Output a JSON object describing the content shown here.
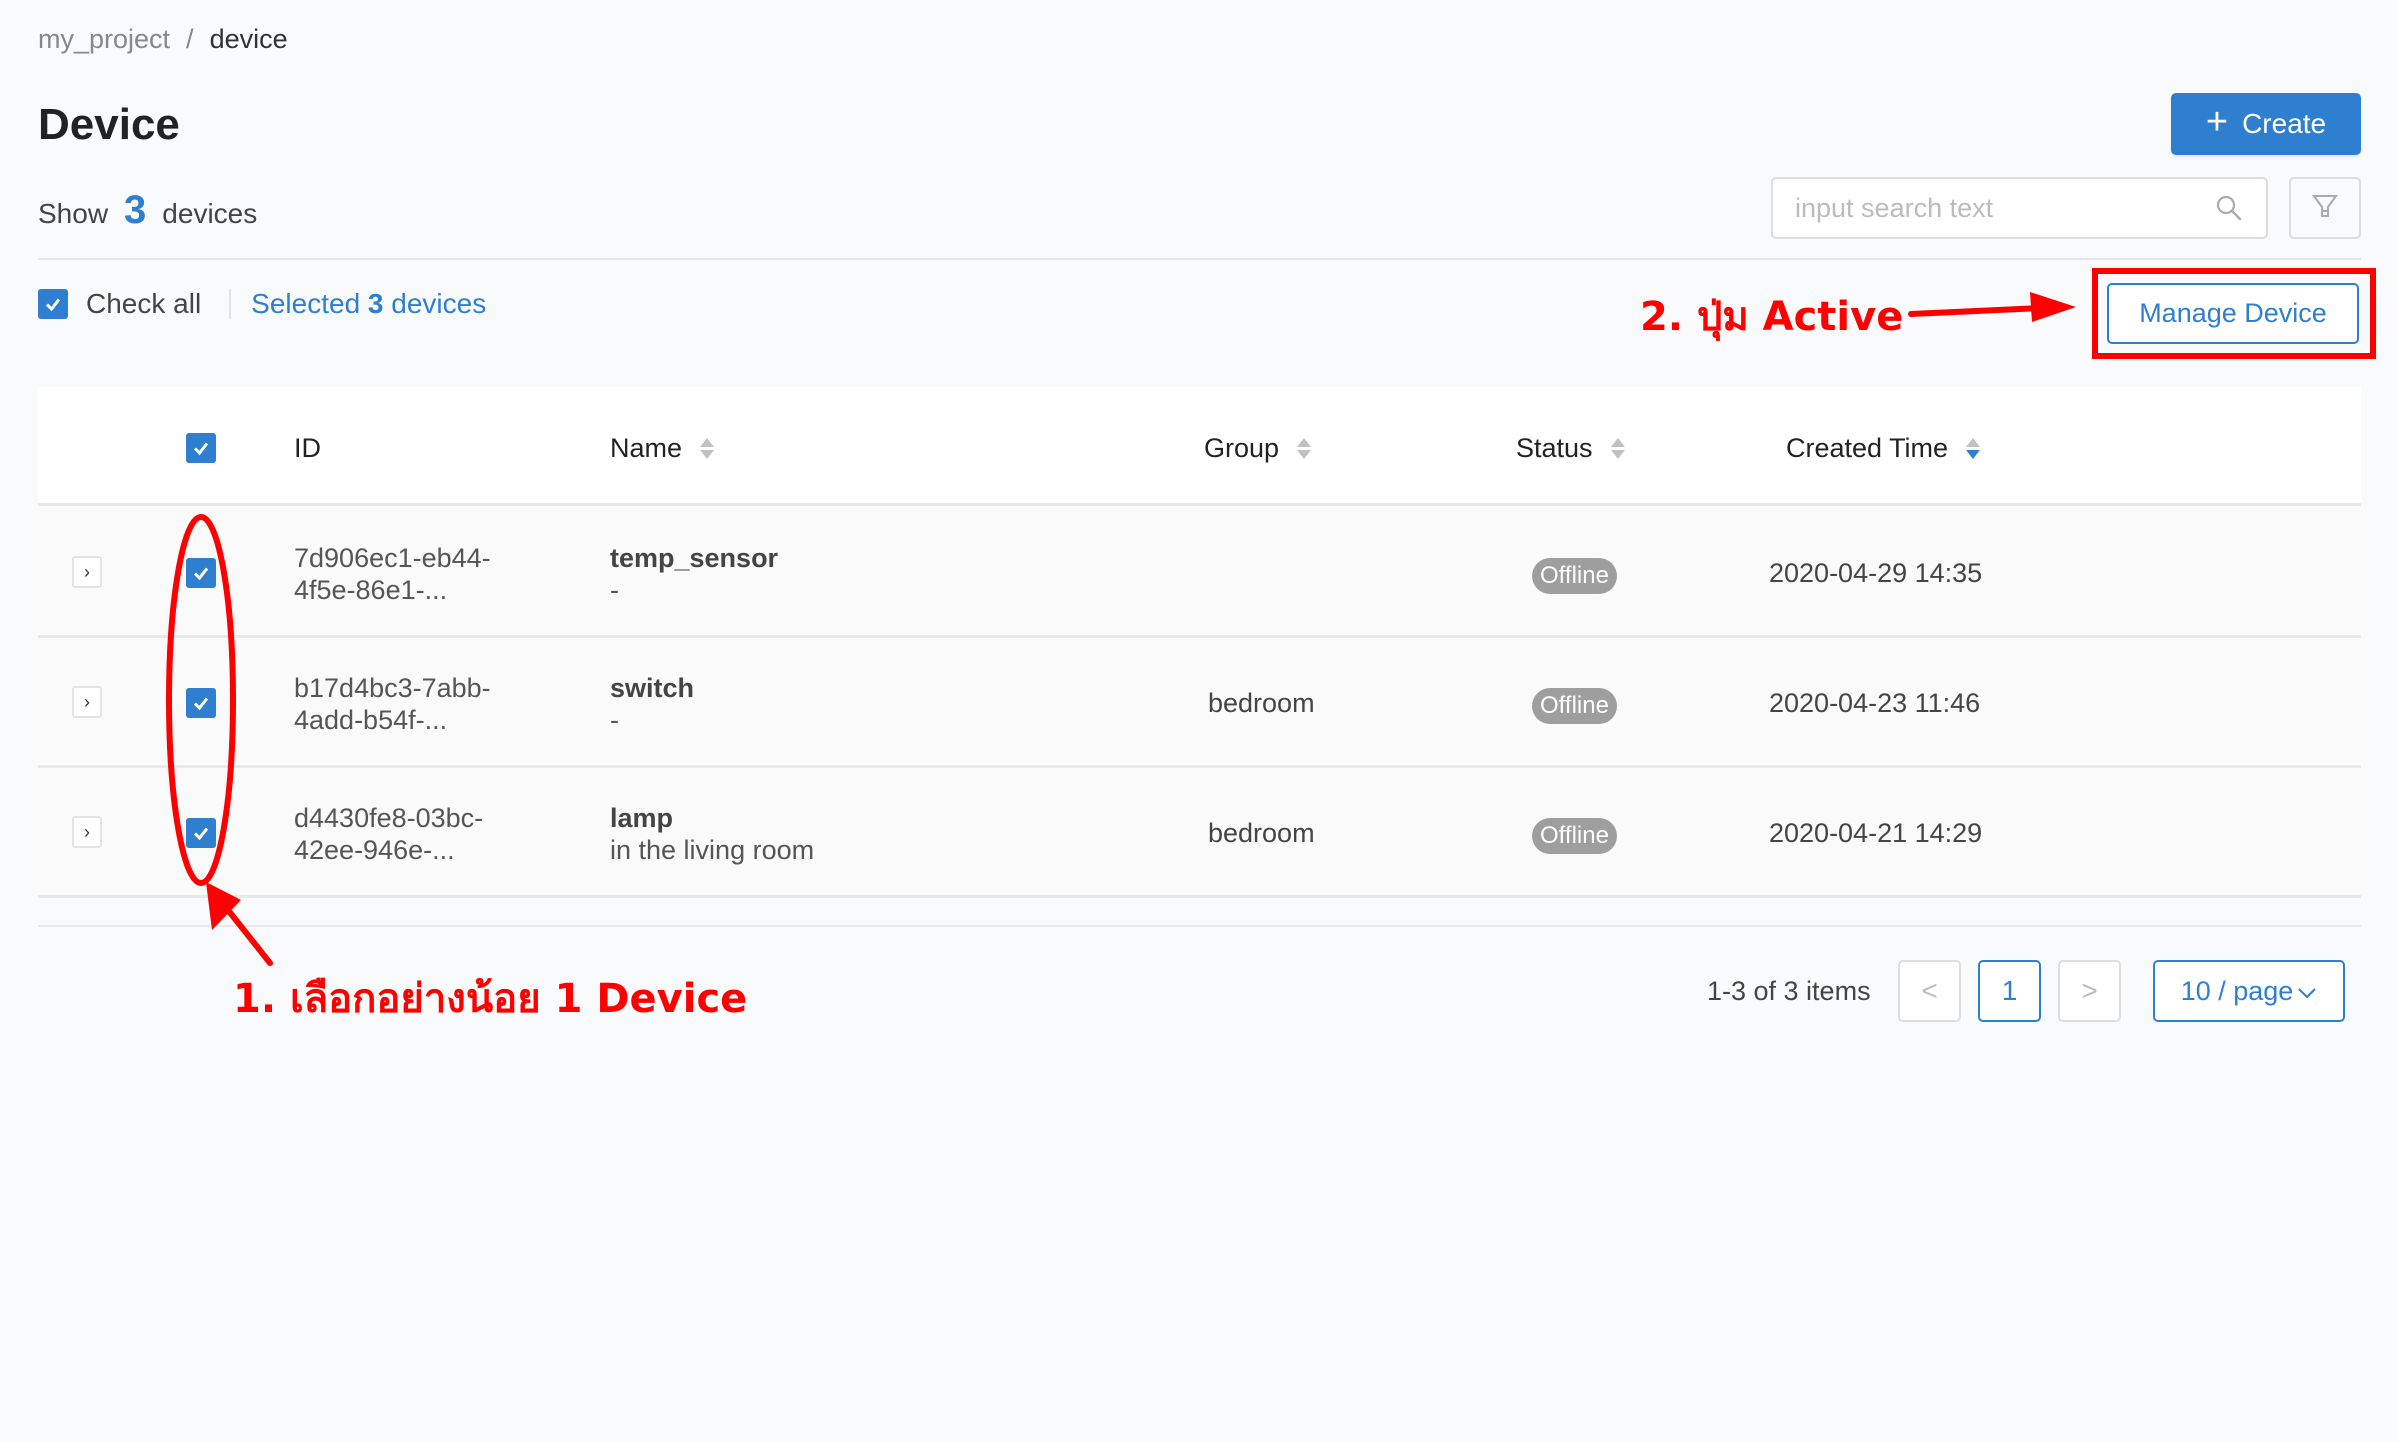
{
  "breadcrumb": {
    "items": [
      "my_project",
      "device"
    ],
    "separator": "/"
  },
  "header": {
    "title": "Device",
    "create_label": "Create",
    "create_icon": "plus-icon"
  },
  "summary": {
    "prefix": "Show",
    "count": "3",
    "suffix": "devices"
  },
  "search": {
    "placeholder": "input search text",
    "value": "",
    "icon": "search-icon",
    "filter_icon": "filter-icon"
  },
  "selection": {
    "check_all_label": "Check all",
    "check_all_checked": true,
    "selected_prefix": "Selected",
    "selected_count": "3",
    "selected_suffix": "devices"
  },
  "toolbar": {
    "manage_label": "Manage Device"
  },
  "annotations": {
    "step2": "2. ปุ่ม Active",
    "step1": "1. เลือกอย่างน้อย 1 Device",
    "color": "#ff0000"
  },
  "table": {
    "columns": [
      {
        "label": "ID",
        "sortable": false
      },
      {
        "label": "Name",
        "sortable": true,
        "sort": "none"
      },
      {
        "label": "Group",
        "sortable": true,
        "sort": "none"
      },
      {
        "label": "Status",
        "sortable": true,
        "sort": "none"
      },
      {
        "label": "Created Time",
        "sortable": true,
        "sort": "descend"
      }
    ],
    "header_checked": true,
    "rows": [
      {
        "id_line1": "7d906ec1-eb44-",
        "id_line2": "4f5e-86e1-...",
        "name": "temp_sensor",
        "description": "-",
        "group": "",
        "status": "Offline",
        "created": "2020-04-29 14:35",
        "checked": true
      },
      {
        "id_line1": "b17d4bc3-7abb-",
        "id_line2": "4add-b54f-...",
        "name": "switch",
        "description": "-",
        "group": "bedroom",
        "status": "Offline",
        "created": "2020-04-23 11:46",
        "checked": true
      },
      {
        "id_line1": "d4430fe8-03bc-",
        "id_line2": "42ee-946e-...",
        "name": "lamp",
        "description": "in the living room",
        "group": "bedroom",
        "status": "Offline",
        "created": "2020-04-21 14:29",
        "checked": true
      }
    ]
  },
  "pagination": {
    "info": "1-3 of 3 items",
    "prev": "<",
    "current_page": "1",
    "next": ">",
    "page_size": "10 / page"
  },
  "colors": {
    "primary": "#2f7fd1",
    "status_offline": "#9e9e9e",
    "annotation": "#ff0000",
    "background": "#f9fafb"
  }
}
